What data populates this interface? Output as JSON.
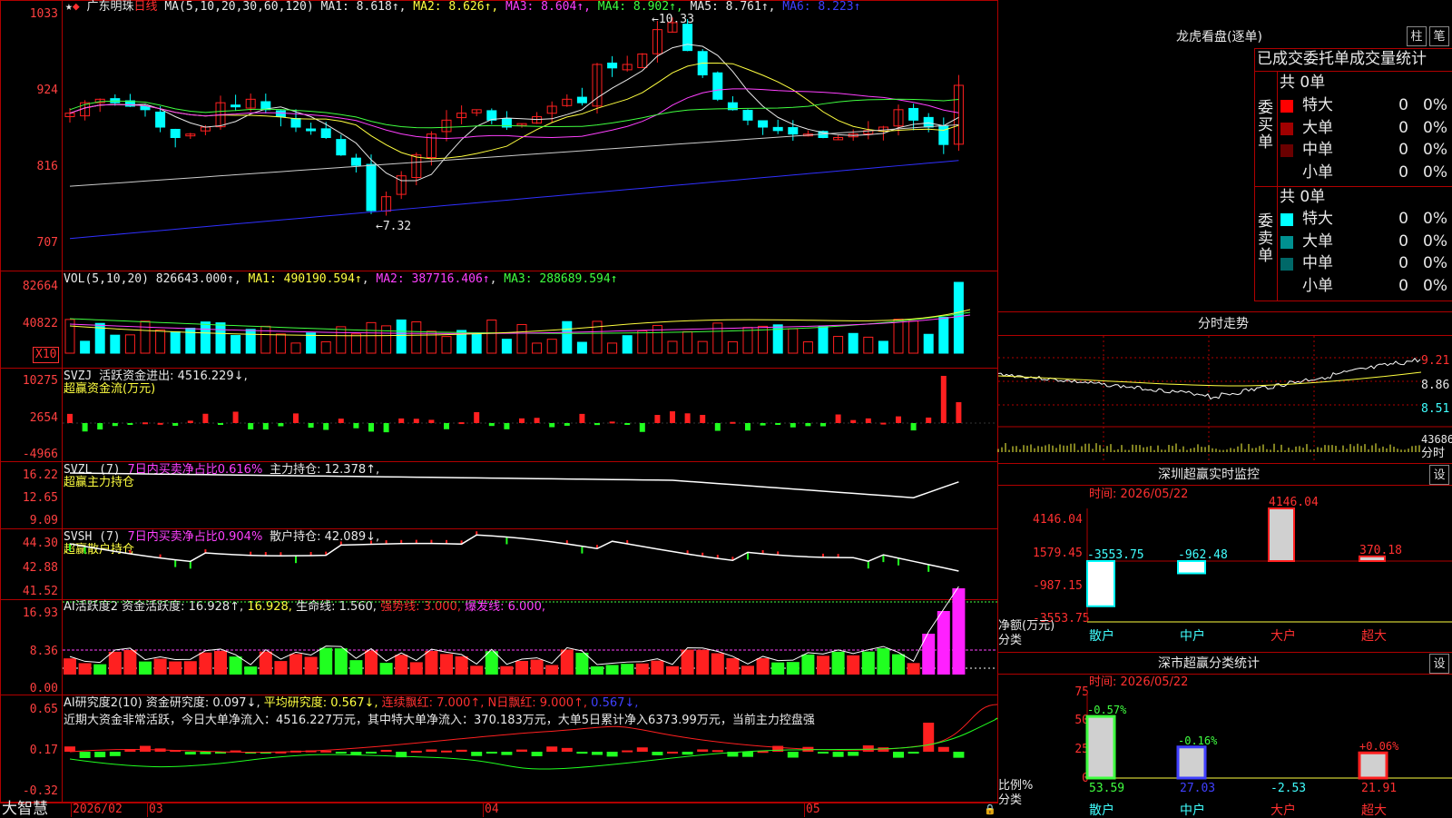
{
  "stock": {
    "star": "★",
    "diamond": "◆",
    "name": "广东明珠",
    "period": "日线"
  },
  "main_pane": {
    "ma_label": "MA(5,10,20,30,60,120)",
    "ma_values": [
      {
        "label": "MA1: 8.618↑",
        "color": "#e8e8e8"
      },
      {
        "label": "MA2: 8.626↑",
        "color": "#ffff40"
      },
      {
        "label": "MA3: 8.604↑",
        "color": "#ff40ff"
      },
      {
        "label": "MA4: 8.902↑",
        "color": "#40ff40"
      },
      {
        "label": "MA5: 8.761↑",
        "color": "#e8e8e8"
      },
      {
        "label": "MA6: 8.223↑",
        "color": "#4040ff"
      }
    ],
    "axis": [
      "1033",
      "924",
      "816",
      "707"
    ],
    "high_annot": "10.33",
    "low_annot": "7.32"
  },
  "vol_pane": {
    "label": "VOL(5,10,20)",
    "value": "826643.000↑",
    "ma1": "MA1: 490190.594↑",
    "ma2": "MA2: 387716.406↑",
    "ma3": "MA3: 288689.594↑",
    "axis": [
      "82664",
      "40822"
    ],
    "unit": "X10"
  },
  "svzj_pane": {
    "label": "SVZJ",
    "desc": "活跃资金进出: 4516.229↓,",
    "sub": "超赢资金流(万元)",
    "axis": [
      "10275",
      "2654",
      "-4966"
    ]
  },
  "svzl_pane": {
    "label": "SVZL (7)",
    "desc": "7日内买卖净占比0.616%",
    "holding": "主力持仓: 12.378↑,",
    "sub": "超赢主力持仓",
    "axis": [
      "16.22",
      "12.65",
      "9.09"
    ]
  },
  "svsh_pane": {
    "label": "SVSH (7)",
    "desc": "7日内买卖净占比0.904%",
    "holding": "散户持仓: 42.089↓,",
    "sub": "超赢散户持仓",
    "axis": [
      "44.30",
      "42.88",
      "41.52"
    ]
  },
  "ai_active_pane": {
    "label": "AI活跃度2",
    "v1": "资金活跃度: 16.928↑,",
    "v2": "16.928,",
    "v3": "生命线: 1.560,",
    "v4": "强势线: 3.000,",
    "v5": "爆发线: 6.000,",
    "axis": [
      "16.93",
      "8.36",
      "0.00"
    ]
  },
  "ai_research_pane": {
    "label": "AI研究度2(10)",
    "v1": "资金研究度: 0.097↓,",
    "v2": "平均研究度: 0.567↓,",
    "v3": "连续飘红: 7.000↑,",
    "v4": "N日飘红: 9.000↑,",
    "v5": "0.567↓,",
    "summary": "近期大资金非常活跃，今日大单净流入：4516.227万元，其中特大单净流入：370.183万元，大单5日累计净入6373.99万元，当前主力控盘强",
    "axis": [
      "0.65",
      "0.17",
      "-0.32"
    ]
  },
  "bottom_bar": {
    "brand": "大智慧",
    "dates": [
      "2026/02",
      "03",
      "04",
      "05"
    ]
  },
  "longhu": {
    "title": "龙虎看盘(逐单)",
    "btn_column": "柱",
    "btn_stroke": "笔",
    "header": "已成交委托单成交量统计",
    "buy_label": "委买单",
    "sell_label": "委卖单",
    "buy_total": "共 0单",
    "sell_total": "共 0单",
    "buy_rows": [
      {
        "name": "特大",
        "color": "#ff0000",
        "count": "0",
        "pct": "0%"
      },
      {
        "name": "大单",
        "color": "#a00000",
        "count": "0",
        "pct": "0%"
      },
      {
        "name": "中单",
        "color": "#6a0000",
        "count": "0",
        "pct": "0%"
      },
      {
        "name": "小单",
        "color": "",
        "count": "0",
        "pct": "0%"
      }
    ],
    "sell_rows": [
      {
        "name": "特大",
        "color": "#00ffff",
        "count": "0",
        "pct": "0%"
      },
      {
        "name": "大单",
        "color": "#009090",
        "count": "0",
        "pct": "0%"
      },
      {
        "name": "中单",
        "color": "#006868",
        "count": "0",
        "pct": "0%"
      },
      {
        "name": "小单",
        "color": "",
        "count": "0",
        "pct": "0%"
      }
    ]
  },
  "intraday": {
    "title": "分时走势",
    "axis": [
      "9.21",
      "8.86",
      "8.51"
    ],
    "vol_axis": "43686",
    "vol_unit": "分时"
  },
  "sz_monitor": {
    "title": "深圳超赢实时监控",
    "settings": "设",
    "time": "时间: 2026/05/22",
    "axis": [
      "4146.04",
      "1579.45",
      "-987.15",
      "-3553.75"
    ],
    "unit": "净额(万元)",
    "unit2": "分类",
    "categories": [
      "散户",
      "中户",
      "大户",
      "超大"
    ],
    "values": [
      -3553.75,
      -962.48,
      4146.04,
      370.18
    ],
    "value_labels": [
      "-3553.75",
      "-962.48",
      "4146.04",
      "370.18"
    ]
  },
  "sz_category": {
    "title": "深市超赢分类统计",
    "settings": "设",
    "time": "时间: 2026/05/22",
    "axis": [
      "75",
      "50",
      "25",
      "0"
    ],
    "unit": "比例%",
    "unit2": "分类",
    "categories": [
      "散户",
      "中户",
      "大户",
      "超大"
    ],
    "bar_values": [
      53.59,
      27.03,
      -2.53,
      21.91
    ],
    "bottom_labels": [
      "53.59",
      "27.03",
      "-2.53",
      "21.91"
    ],
    "change_labels": [
      "-0.57%",
      "-0.16%",
      "",
      "+0.06%"
    ]
  },
  "colors": {
    "up": "#ff2020",
    "down": "#00ffff",
    "frame": "#b00000",
    "axis": "#ff4040"
  }
}
